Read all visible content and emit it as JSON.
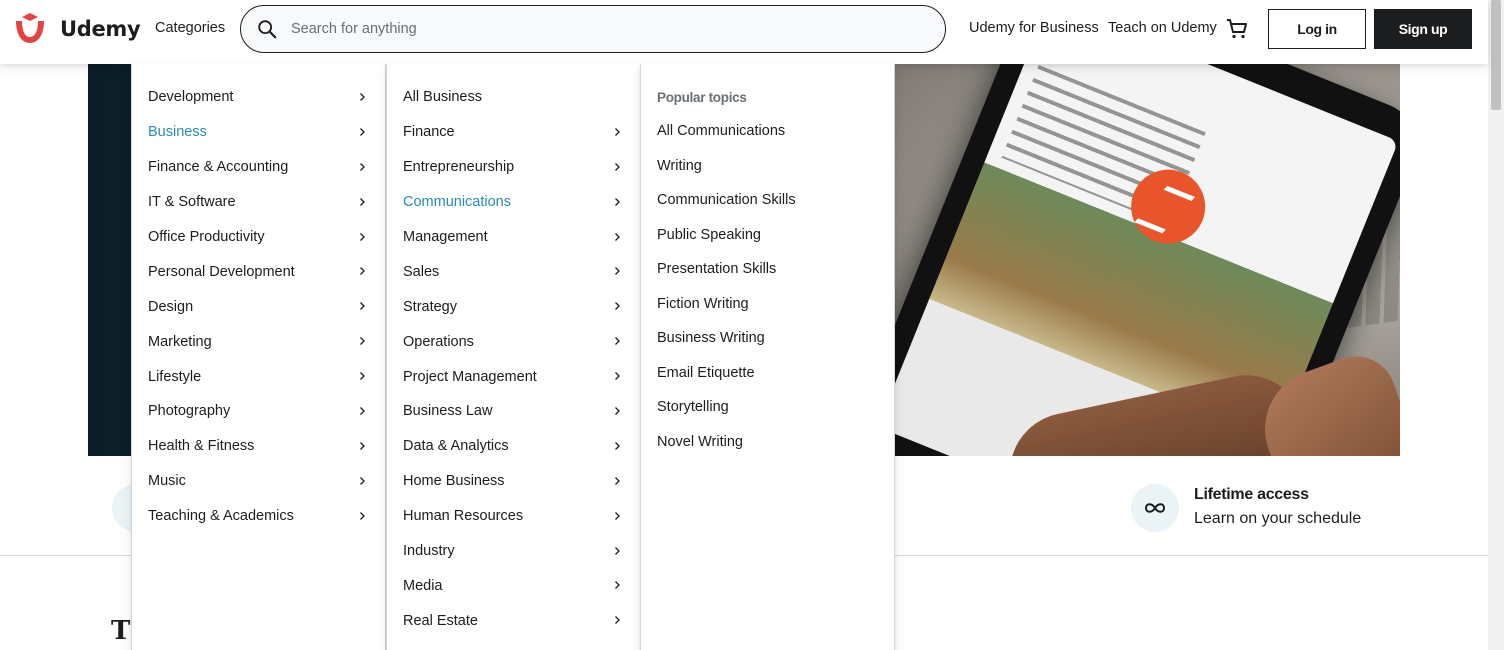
{
  "brand": {
    "logo_text": "Udemy",
    "accent": "#a435f0",
    "logo_color": "#e04444"
  },
  "header": {
    "categories_label": "Categories",
    "search_placeholder": "Search for anything",
    "business_link": "Udemy for Business",
    "teach_link": "Teach on Udemy",
    "login_label": "Log in",
    "signup_label": "Sign up"
  },
  "menu": {
    "categories": [
      {
        "label": "Development",
        "active": false
      },
      {
        "label": "Business",
        "active": true
      },
      {
        "label": "Finance & Accounting",
        "active": false
      },
      {
        "label": "IT & Software",
        "active": false
      },
      {
        "label": "Office Productivity",
        "active": false
      },
      {
        "label": "Personal Development",
        "active": false
      },
      {
        "label": "Design",
        "active": false
      },
      {
        "label": "Marketing",
        "active": false
      },
      {
        "label": "Lifestyle",
        "active": false
      },
      {
        "label": "Photography",
        "active": false
      },
      {
        "label": "Health & Fitness",
        "active": false
      },
      {
        "label": "Music",
        "active": false
      },
      {
        "label": "Teaching & Academics",
        "active": false
      }
    ],
    "subcategories": [
      {
        "label": "All Business",
        "chevron": false,
        "active": false
      },
      {
        "label": "Finance",
        "chevron": true,
        "active": false
      },
      {
        "label": "Entrepreneurship",
        "chevron": true,
        "active": false
      },
      {
        "label": "Communications",
        "chevron": true,
        "active": true
      },
      {
        "label": "Management",
        "chevron": true,
        "active": false
      },
      {
        "label": "Sales",
        "chevron": true,
        "active": false
      },
      {
        "label": "Strategy",
        "chevron": true,
        "active": false
      },
      {
        "label": "Operations",
        "chevron": true,
        "active": false
      },
      {
        "label": "Project Management",
        "chevron": true,
        "active": false
      },
      {
        "label": "Business Law",
        "chevron": true,
        "active": false
      },
      {
        "label": "Data & Analytics",
        "chevron": true,
        "active": false
      },
      {
        "label": "Home Business",
        "chevron": true,
        "active": false
      },
      {
        "label": "Human Resources",
        "chevron": true,
        "active": false
      },
      {
        "label": "Industry",
        "chevron": true,
        "active": false
      },
      {
        "label": "Media",
        "chevron": true,
        "active": false
      },
      {
        "label": "Real Estate",
        "chevron": true,
        "active": false
      }
    ],
    "popular_title": "Popular topics",
    "popular_topics": [
      "All Communications",
      "Writing",
      "Communication Skills",
      "Public Speaking",
      "Presentation Skills",
      "Fiction Writing",
      "Business Writing",
      "Email Etiquette",
      "Storytelling",
      "Novel Writing"
    ]
  },
  "features": {
    "lifetime_title": "Lifetime access",
    "lifetime_sub": "Learn on your schedule"
  },
  "page": {
    "heading_partial": "Th"
  },
  "icons": {
    "search": "search-icon",
    "cart": "cart-icon",
    "chevron": "chevron-right-icon",
    "infinity": "infinity-icon"
  }
}
